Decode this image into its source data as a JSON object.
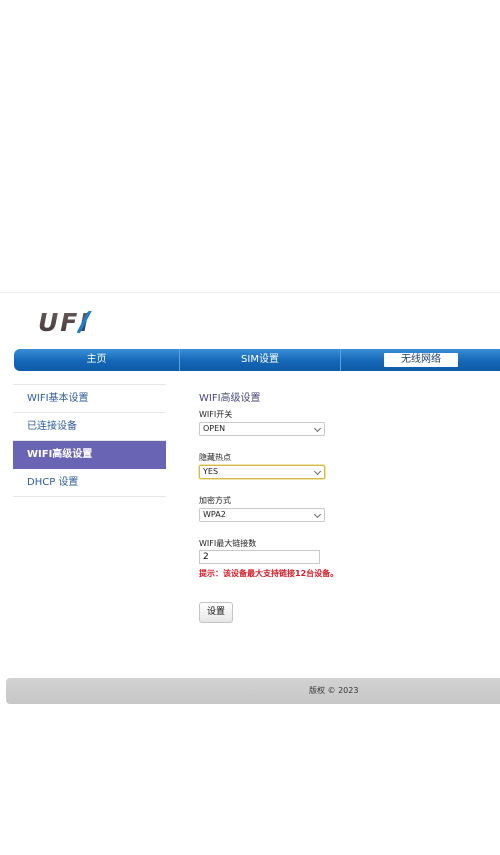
{
  "logo": {
    "text": "UFI",
    "accent": "#1d7fd1"
  },
  "nav": {
    "items": [
      {
        "label": "主页"
      },
      {
        "label": "SIM设置"
      },
      {
        "label": "无线网络"
      }
    ],
    "active_index": 2,
    "bar_color": "#1467b7"
  },
  "sidebar": {
    "items": [
      {
        "label": "WIFI基本设置"
      },
      {
        "label": "已连接设备"
      },
      {
        "label": "WIFI高级设置"
      },
      {
        "label": "DHCP 设置"
      }
    ],
    "active_index": 2,
    "active_color": "#6a64b4"
  },
  "form": {
    "title": "WIFI高级设置",
    "wifi_switch": {
      "label": "WIFI开关",
      "value": "OPEN"
    },
    "hidden_ssid": {
      "label": "隐藏热点",
      "value": "YES"
    },
    "encryption": {
      "label": "加密方式",
      "value": "WPA2"
    },
    "max_connections": {
      "label": "WIFI最大链接数",
      "value": "2"
    },
    "hint": "提示：该设备最大支持链接12台设备。",
    "hint_color": "#d0202a",
    "submit_label": "设置"
  },
  "footer": {
    "text": "版权 © 2023"
  }
}
